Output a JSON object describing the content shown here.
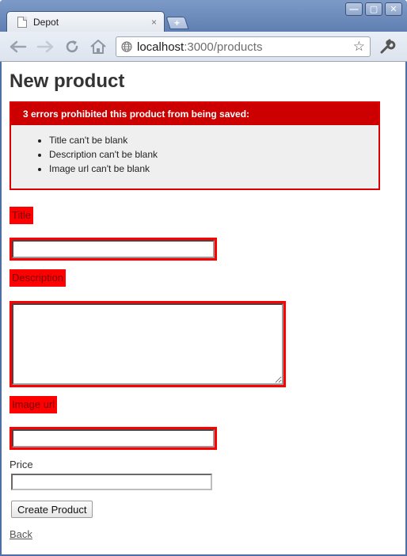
{
  "browser": {
    "tab_title": "Depot",
    "tab_close": "×",
    "new_tab": "+",
    "url_host": "localhost",
    "url_rest": ":3000/products",
    "window_buttons": [
      "—",
      "▢",
      "✕"
    ]
  },
  "page": {
    "heading": "New product",
    "error_header": "3 errors prohibited this product from being saved:",
    "errors": [
      "Title can't be blank",
      "Description can't be blank",
      "Image url can't be blank"
    ],
    "fields": {
      "title_label": "Title",
      "title_value": "",
      "description_label": "Description",
      "description_value": "",
      "image_url_label": "Image url",
      "image_url_value": "",
      "price_label": "Price",
      "price_value": ""
    },
    "submit_label": "Create Product",
    "back_label": "Back"
  },
  "colors": {
    "error_red": "#ff0000",
    "error_header_red": "#cc0000",
    "chrome_blue": "#5f7fb2"
  }
}
